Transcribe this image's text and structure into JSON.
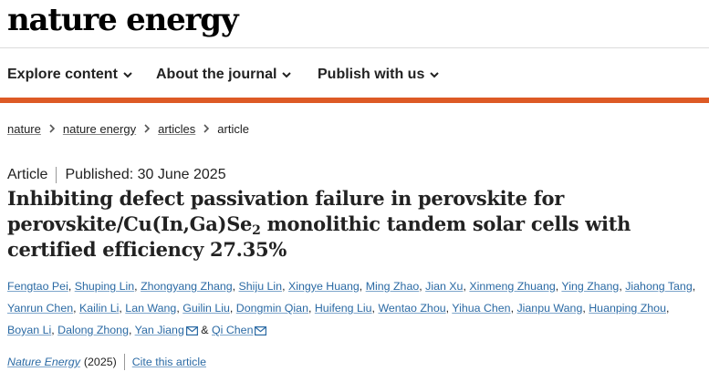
{
  "header": {
    "logo_text": "nature energy"
  },
  "nav": {
    "items": [
      {
        "label": "Explore content",
        "icon": "chevron-down-icon"
      },
      {
        "label": "About the journal",
        "icon": "chevron-down-icon"
      },
      {
        "label": "Publish with us",
        "icon": "chevron-down-icon"
      }
    ]
  },
  "colors": {
    "brand_bar": "#dd5a25",
    "link": "#2b6aa4"
  },
  "breadcrumb": {
    "items": [
      "nature",
      "nature energy",
      "articles"
    ],
    "current": "article"
  },
  "article": {
    "type": "Article",
    "published": "Published: 30 June 2025",
    "title_part1": "Inhibiting defect passivation failure in perovskite for perovskite/Cu(In,Ga)Se",
    "title_subscript": "2",
    "title_part2": " monolithic tandem solar cells with certified efficiency 27.35%"
  },
  "authors": [
    {
      "name": "Fengtao Pei",
      "sep": ", ",
      "mail": false
    },
    {
      "name": "Shuping Lin",
      "sep": ", ",
      "mail": false
    },
    {
      "name": "Zhongyang Zhang",
      "sep": ", ",
      "mail": false
    },
    {
      "name": "Shiju Lin",
      "sep": ", ",
      "mail": false
    },
    {
      "name": "Xingye Huang",
      "sep": ", ",
      "mail": false
    },
    {
      "name": "Ming Zhao",
      "sep": ", ",
      "mail": false
    },
    {
      "name": "Jian Xu",
      "sep": ", ",
      "mail": false
    },
    {
      "name": "Xinmeng Zhuang",
      "sep": ", ",
      "mail": false
    },
    {
      "name": "Ying Zhang",
      "sep": ", ",
      "mail": false
    },
    {
      "name": "Jiahong Tang",
      "sep": ", ",
      "mail": false
    },
    {
      "name": "Yanrun Chen",
      "sep": ", ",
      "mail": false
    },
    {
      "name": "Kailin Li",
      "sep": ", ",
      "mail": false
    },
    {
      "name": "Lan Wang",
      "sep": ", ",
      "mail": false
    },
    {
      "name": "Guilin Liu",
      "sep": ", ",
      "mail": false
    },
    {
      "name": "Dongmin Qian",
      "sep": ", ",
      "mail": false
    },
    {
      "name": "Huifeng Liu",
      "sep": ", ",
      "mail": false
    },
    {
      "name": "Wentao Zhou",
      "sep": ", ",
      "mail": false
    },
    {
      "name": "Yihua Chen",
      "sep": ", ",
      "mail": false
    },
    {
      "name": "Jianpu Wang",
      "sep": ", ",
      "mail": false
    },
    {
      "name": "Huanping Zhou",
      "sep": ", ",
      "mail": false
    },
    {
      "name": "Boyan Li",
      "sep": ", ",
      "mail": false
    },
    {
      "name": "Dalong Zhong",
      "sep": ", ",
      "mail": false
    },
    {
      "name": "Yan Jiang",
      "sep": " & ",
      "mail": true
    },
    {
      "name": "Qi Chen",
      "sep": "",
      "mail": true
    }
  ],
  "citation": {
    "journal": "Nature Energy",
    "year": "(2025)",
    "cite_label": "Cite this article"
  }
}
